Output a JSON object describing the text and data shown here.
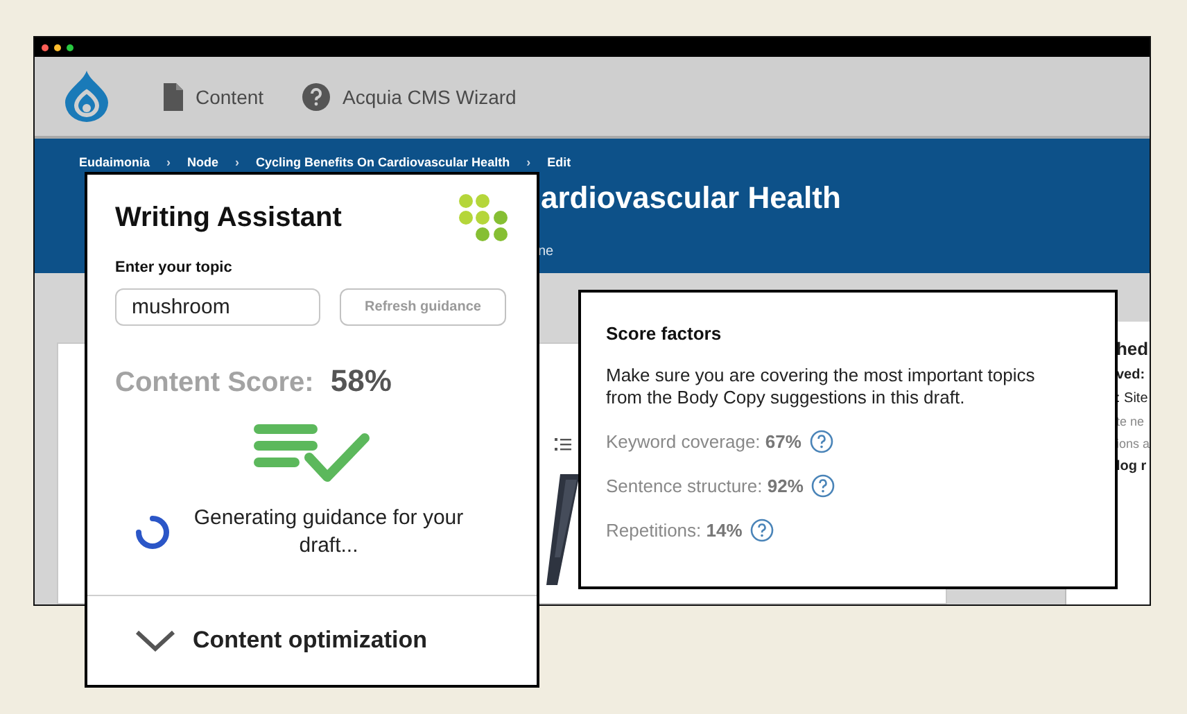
{
  "nav": {
    "items": [
      {
        "label": "Content"
      },
      {
        "label": "Acquia CMS Wizard"
      }
    ]
  },
  "breadcrumbs": {
    "separator": "›",
    "items": [
      "Eudaimonia",
      "Node",
      "Cycling Benefits On Cardiovascular Health",
      "Edit"
    ]
  },
  "page_title": "ardiovascular Health",
  "tab_fragment": "ne",
  "sidebar_fragments": [
    {
      "text": "hed",
      "kind": "heading"
    },
    {
      "text": "ved:",
      "kind": "strong"
    },
    {
      "text": ": Site",
      "kind": "plain"
    },
    {
      "text": "te ne",
      "kind": "muted"
    },
    {
      "text": "ions a",
      "kind": "muted"
    },
    {
      "text": "log r",
      "kind": "strong"
    }
  ],
  "writing_assistant": {
    "title": "Writing Assistant",
    "topic_label": "Enter your topic",
    "topic_value": "mushroom",
    "refresh_button": "Refresh guidance",
    "score_label": "Content Score:",
    "score_value": "58%",
    "status": "Generating guidance for your draft...",
    "section_title": "Content optimization"
  },
  "score_factors": {
    "title": "Score factors",
    "description": "Make sure you are covering the most important topics from the Body Copy suggestions in this draft.",
    "factors": [
      {
        "label": "Keyword coverage:",
        "value": "67%"
      },
      {
        "label": "Sentence structure:",
        "value": "92%"
      },
      {
        "label": "Repetitions:",
        "value": "14%"
      }
    ]
  }
}
